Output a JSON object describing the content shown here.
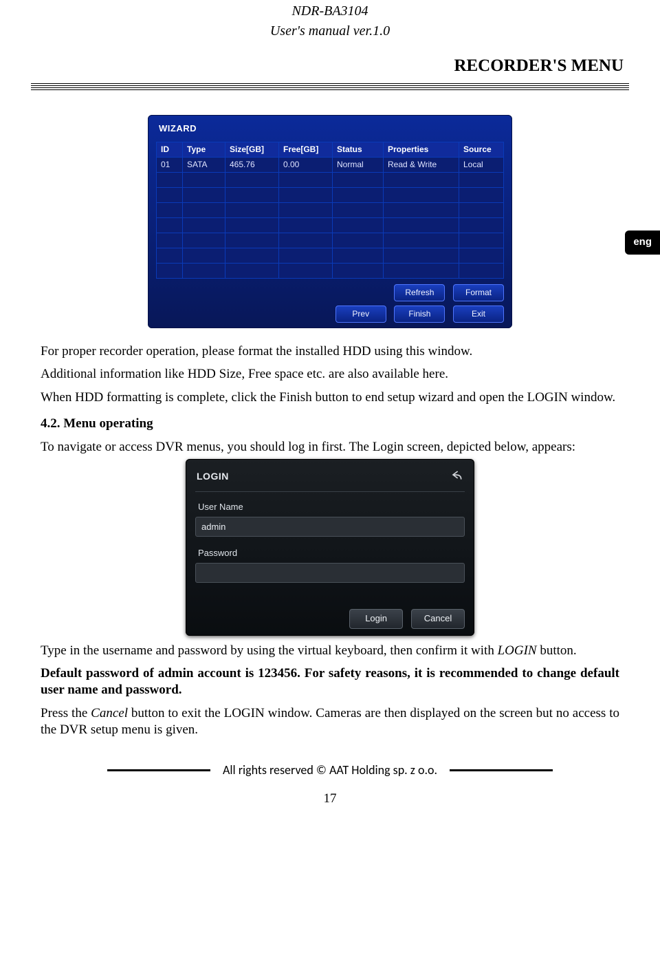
{
  "header": {
    "model": "NDR-BA3104",
    "manual": "User's manual ver.1.0",
    "section_title": "RECORDER'S MENU",
    "lang_tab": "eng"
  },
  "wizard": {
    "title": "WIZARD",
    "columns": [
      "ID",
      "Type",
      "Size[GB]",
      "Free[GB]",
      "Status",
      "Properties",
      "Source"
    ],
    "rows": [
      {
        "id": "01",
        "type": "SATA",
        "size": "465.76",
        "free": "0.00",
        "status": "Normal",
        "properties": "Read & Write",
        "source": "Local"
      }
    ],
    "blank_rows": 7,
    "buttons": {
      "refresh": "Refresh",
      "format": "Format",
      "prev": "Prev",
      "finish": "Finish",
      "exit": "Exit"
    }
  },
  "body": {
    "p1": "For proper recorder operation, please format the installed HDD using this window.",
    "p2": "Additional information like HDD Size, Free space etc. are also available here.",
    "p3": "When HDD formatting is complete, click the Finish button to end setup wizard and open the LOGIN window.",
    "subhead": "4.2. Menu operating",
    "p4": "To navigate or access DVR menus, you should log in first. The  Login screen, depicted below, appears:",
    "p5_pre": "Type in the username and password by using the virtual keyboard, then confirm it with ",
    "p5_italic": "LOGIN",
    "p5_post": " button.",
    "p6": "Default password of admin account is 123456.  For safety reasons, it is recommended to change default user name and password.",
    "p7_pre": "Press the ",
    "p7_italic": "Cancel",
    "p7_post": " button to exit the LOGIN window. Cameras are then displayed on the screen  but no access to the DVR setup menu is given."
  },
  "login": {
    "title": "LOGIN",
    "username_label": "User Name",
    "username_value": "admin",
    "password_label": "Password",
    "password_value": "",
    "buttons": {
      "login": "Login",
      "cancel": "Cancel"
    }
  },
  "footer": {
    "rights": "All rights reserved © AAT Holding sp. z o.o.",
    "page_number": "17"
  }
}
